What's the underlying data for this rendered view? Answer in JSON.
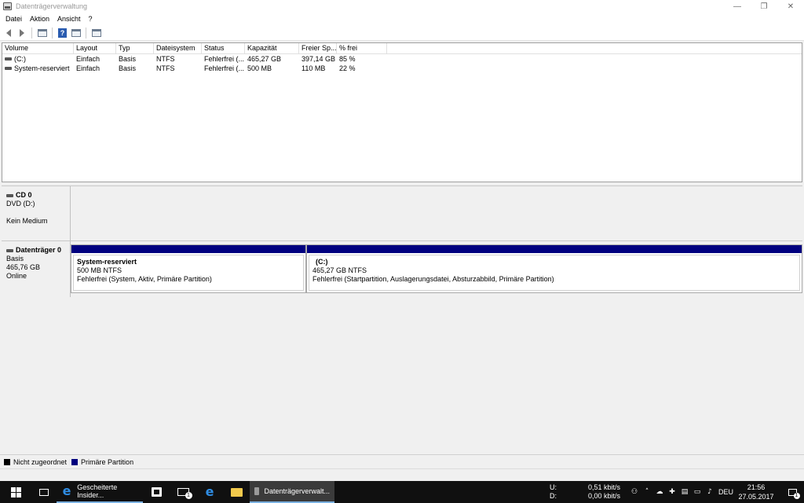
{
  "window": {
    "title": "Datenträgerverwaltung",
    "minimize_glyph": "—",
    "restore_glyph": "❐",
    "close_glyph": "✕"
  },
  "menu": [
    "Datei",
    "Aktion",
    "Ansicht",
    "?"
  ],
  "toolbar": {
    "back_icon": "arrow-left-icon",
    "forward_icon": "arrow-right-icon",
    "help_glyph": "?"
  },
  "volume_list": {
    "columns": [
      "Volume",
      "Layout",
      "Typ",
      "Dateisystem",
      "Status",
      "Kapazität",
      "Freier Sp...",
      "% frei"
    ],
    "rows": [
      {
        "volume": "(C:)",
        "layout": "Einfach",
        "typ": "Basis",
        "dateisystem": "NTFS",
        "status": "Fehlerfrei (...",
        "kapazitaet": "465,27 GB",
        "freier": "397,14 GB",
        "prozent": "85 %"
      },
      {
        "volume": "System-reserviert",
        "layout": "Einfach",
        "typ": "Basis",
        "dateisystem": "NTFS",
        "status": "Fehlerfrei (...",
        "kapazitaet": "500 MB",
        "freier": "110 MB",
        "prozent": "22 %"
      }
    ]
  },
  "disks": [
    {
      "name": "CD 0",
      "line1": "DVD (D:)",
      "line2": "",
      "line3": "Kein Medium"
    },
    {
      "name": "Datenträger 0",
      "line1": "Basis",
      "line2": "465,76 GB",
      "line3": "Online",
      "partitions": [
        {
          "name": "System-reserviert",
          "size": "500 MB NTFS",
          "status": "Fehlerfrei (System, Aktiv, Primäre Partition)"
        },
        {
          "name": "(C:)",
          "size": "465,27 GB NTFS",
          "status": "Fehlerfrei (Startpartition, Auslagerungsdatei, Absturzabbild, Primäre Partition)"
        }
      ]
    }
  ],
  "legend": [
    {
      "label": "Nicht zugeordnet",
      "color": "#000000"
    },
    {
      "label": "Primäre Partition",
      "color": "#00007f"
    }
  ],
  "colors": {
    "primary_partition": "#00007f",
    "taskbar": "#101010"
  },
  "taskbar": {
    "apps": [
      {
        "label": "Gescheiterte Insider...",
        "icon": "edge-icon"
      },
      {
        "label": "Datenträgerverwalt...",
        "icon": "disk-management-icon"
      }
    ],
    "mail_badge": "1",
    "network": {
      "up_label": "U:",
      "up_value": "0,51 kbit/s",
      "down_label": "D:",
      "down_value": "0,00 kbit/s"
    },
    "language": "DEU",
    "time": "21:56",
    "date": "27.05.2017",
    "notification_badge": "1"
  }
}
